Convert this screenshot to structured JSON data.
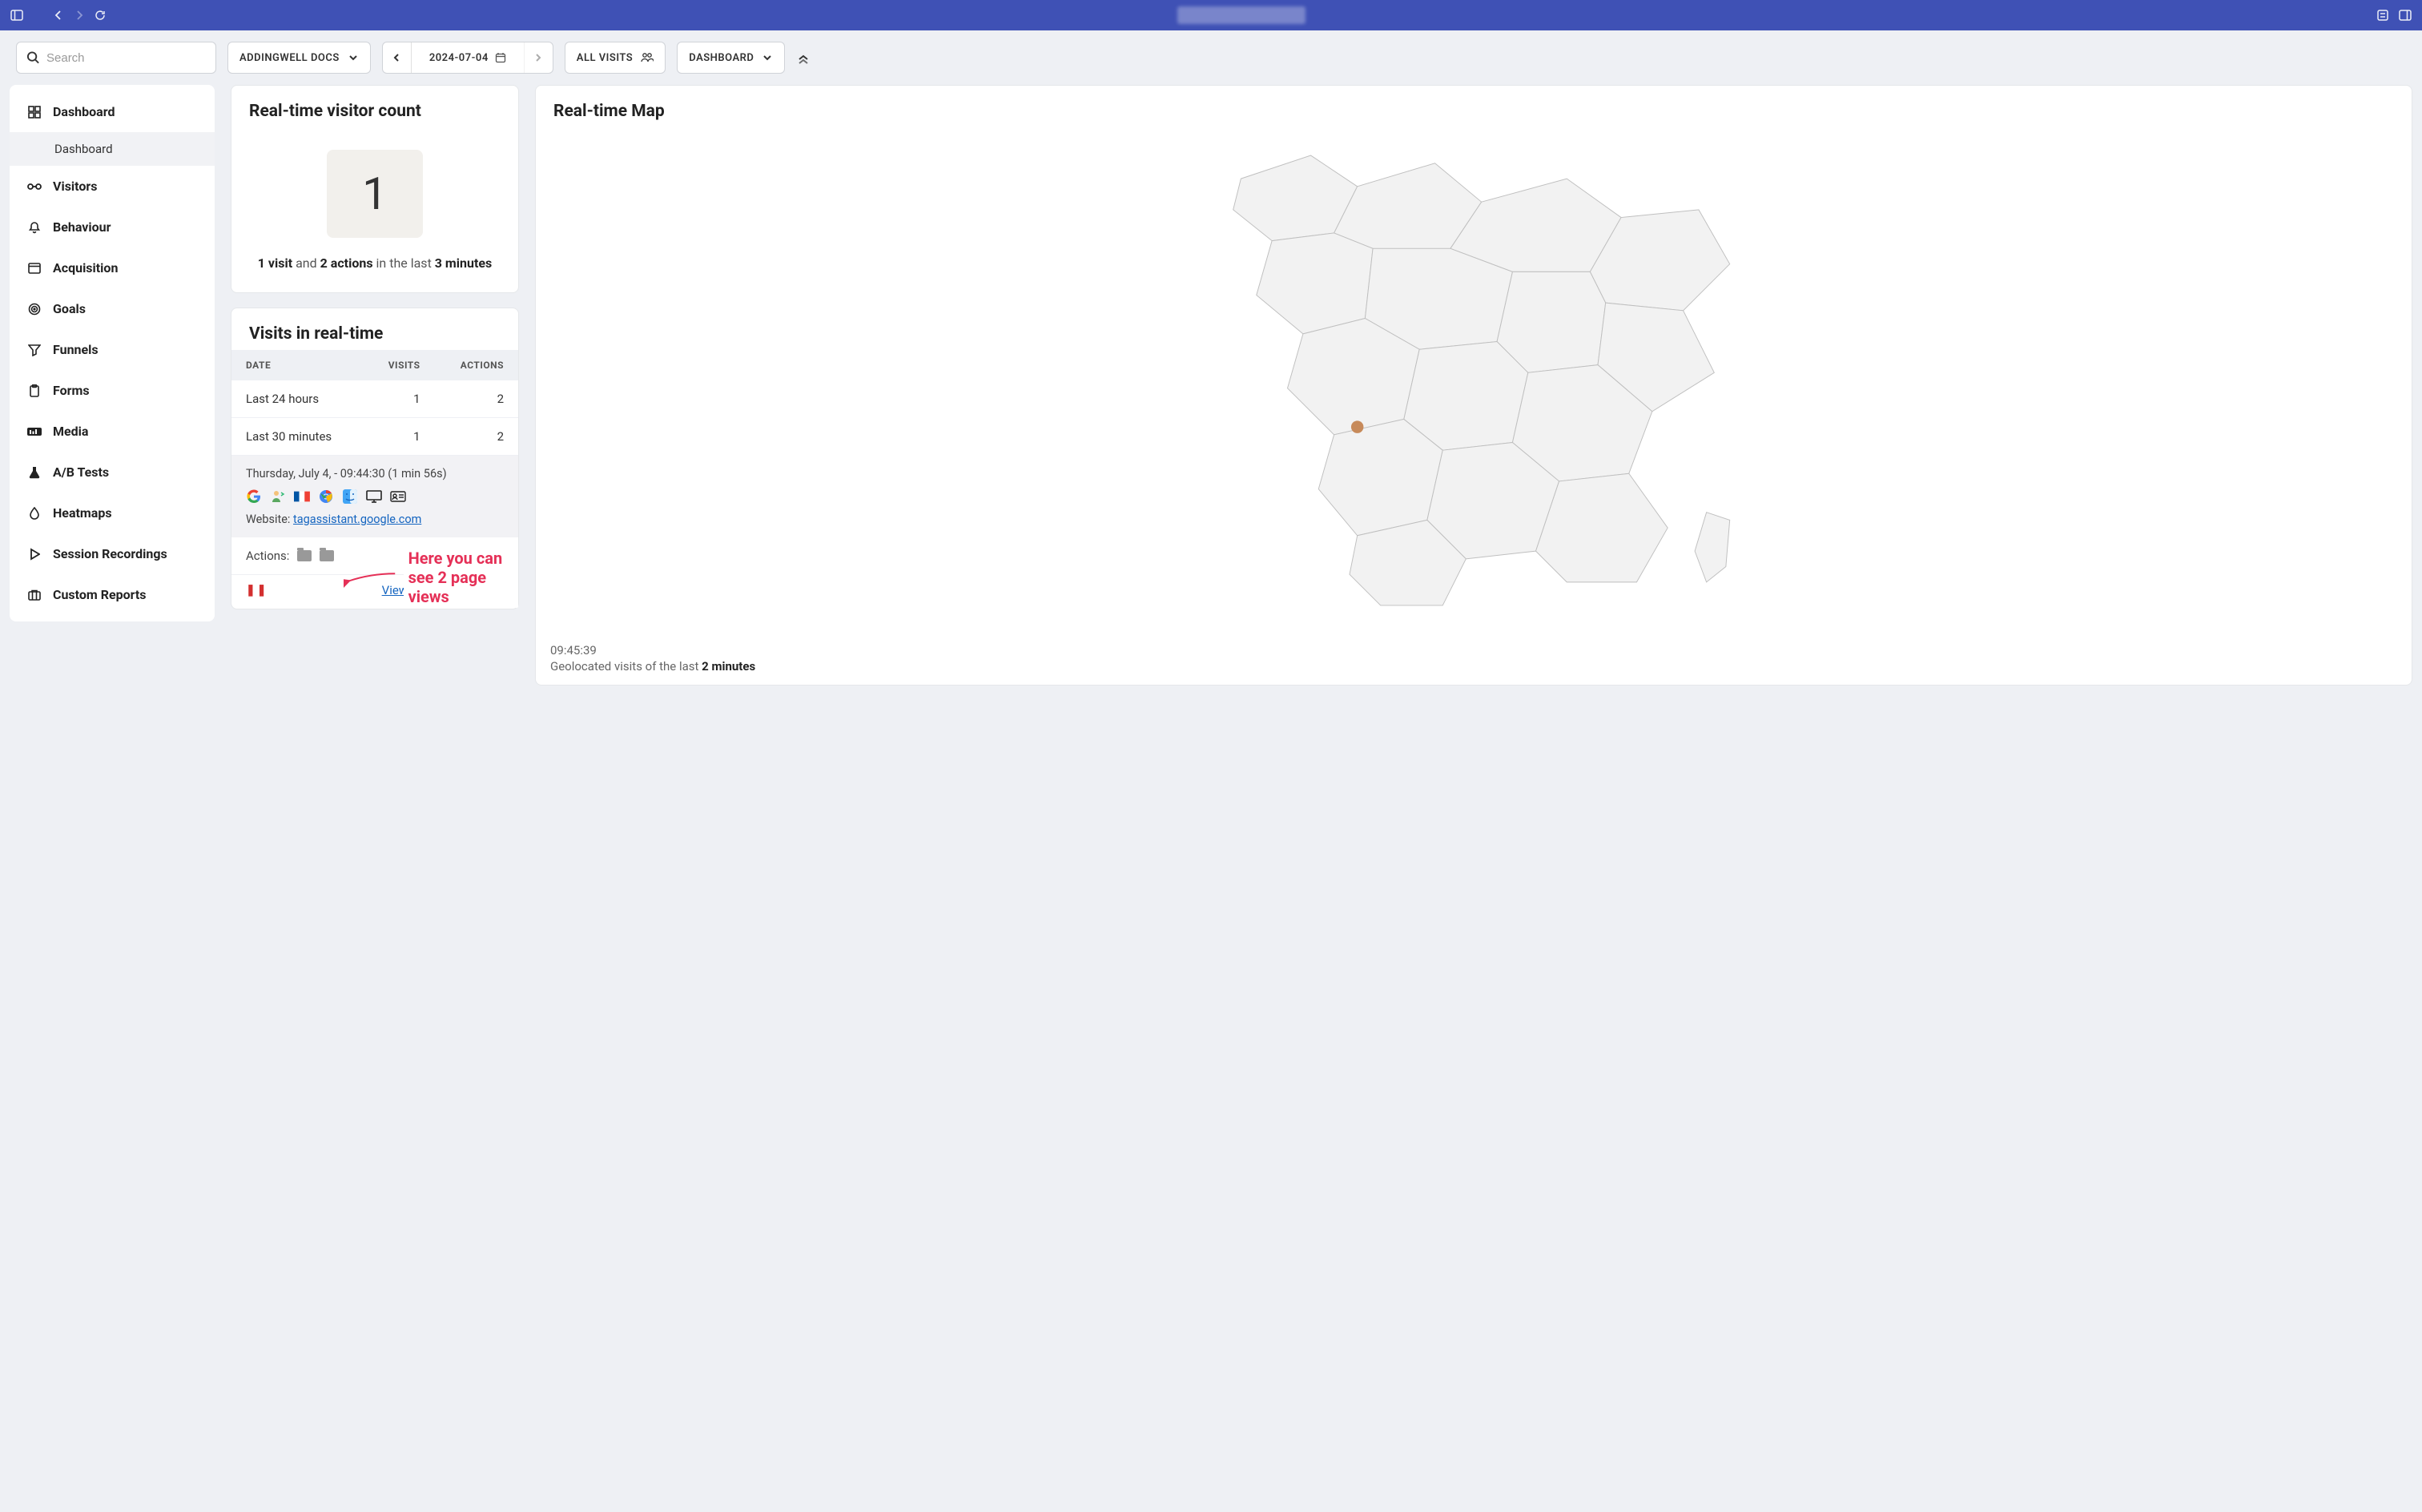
{
  "browser": {
    "url": ""
  },
  "toolbar": {
    "search_placeholder": "Search",
    "site_label": "ADDINGWELL DOCS",
    "date": "2024-07-04",
    "segment_label": "ALL VISITS",
    "dashboard_label": "DASHBOARD"
  },
  "sidebar": {
    "items": [
      {
        "label": "Dashboard",
        "icon": "dashboard-icon",
        "subs": [
          "Dashboard"
        ]
      },
      {
        "label": "Visitors",
        "icon": "visitors-icon"
      },
      {
        "label": "Behaviour",
        "icon": "bell-icon"
      },
      {
        "label": "Acquisition",
        "icon": "window-icon"
      },
      {
        "label": "Goals",
        "icon": "target-icon"
      },
      {
        "label": "Funnels",
        "icon": "funnel-icon"
      },
      {
        "label": "Forms",
        "icon": "clipboard-icon"
      },
      {
        "label": "Media",
        "icon": "media-icon"
      },
      {
        "label": "A/B Tests",
        "icon": "flask-icon"
      },
      {
        "label": "Heatmaps",
        "icon": "drop-icon"
      },
      {
        "label": "Session Recordings",
        "icon": "play-icon"
      },
      {
        "label": "Custom Reports",
        "icon": "suitcase-icon"
      }
    ]
  },
  "realtime_count": {
    "title": "Real-time visitor count",
    "big_number": "1",
    "summary_visits": "1 visit",
    "summary_and": " and ",
    "summary_actions": "2 actions",
    "summary_mid": " in the last ",
    "summary_minutes": "3 minutes"
  },
  "visits_realtime": {
    "title": "Visits in real-time",
    "headers": {
      "date": "DATE",
      "visits": "VISITS",
      "actions": "ACTIONS"
    },
    "rows": [
      {
        "date": "Last 24 hours",
        "visits": "1",
        "actions": "2"
      },
      {
        "date": "Last 30 minutes",
        "visits": "1",
        "actions": "2"
      }
    ],
    "detail": {
      "line1": "Thursday, July 4, - 09:44:30 (1 min 56s)",
      "website_label": "Website: ",
      "website_link": "tagassistant.google.com"
    },
    "actions_label": "Actions:",
    "view_log": "View detailed visits log"
  },
  "realtime_map": {
    "title": "Real-time Map",
    "time": "09:45:39",
    "footer_prefix": "Geolocated visits of the last ",
    "footer_bold": "2 minutes"
  },
  "annotation": {
    "text": "Here you can see 2 page views"
  }
}
